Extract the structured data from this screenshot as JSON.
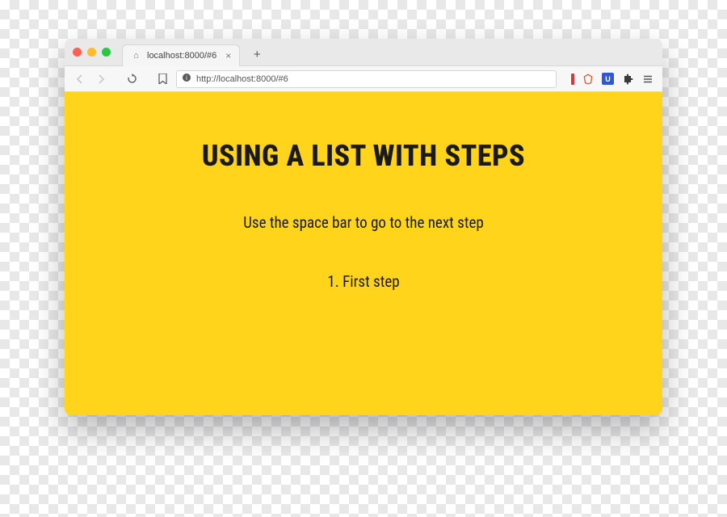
{
  "window": {
    "traffic_lights": [
      "red",
      "yellow",
      "green"
    ]
  },
  "tab": {
    "title": "localhost:8000/#6",
    "favicon_glyph": "⌂"
  },
  "toolbar": {
    "url": "http://localhost:8000/#6"
  },
  "extensions": {
    "ublock_label": "U"
  },
  "slide": {
    "heading": "USING A LIST WITH STEPS",
    "subtitle": "Use the space bar to go to the next step",
    "steps": [
      {
        "num": "1.",
        "text": "First step"
      }
    ]
  },
  "colors": {
    "page_bg": "#ffd41a",
    "text": "#1a1a1a"
  }
}
